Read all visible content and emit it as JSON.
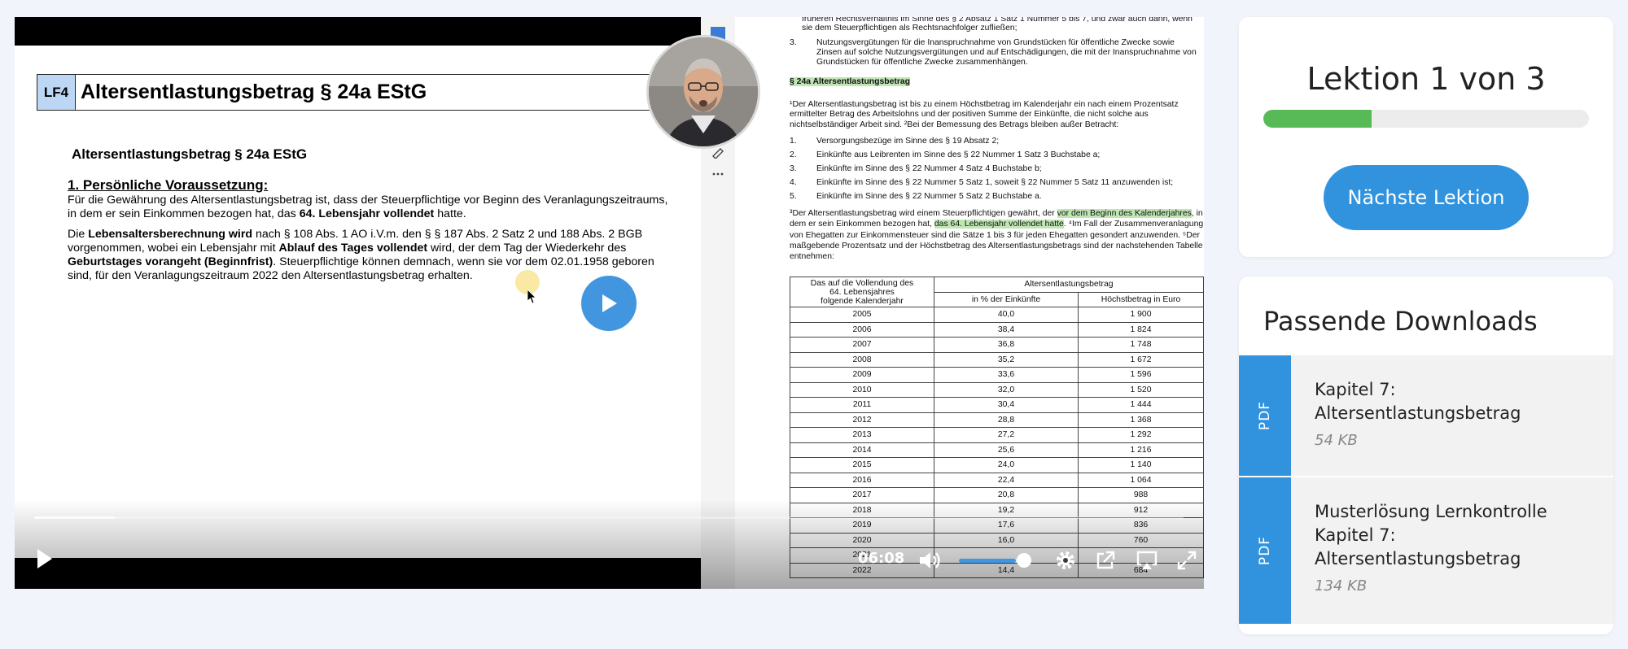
{
  "video": {
    "slide": {
      "tag": "LF4",
      "title": "Altersentlastungsbetrag  § 24a EStG",
      "subtitle": "Altersentlastungsbetrag  § 24a EStG",
      "section": "1. Persönliche Voraussetzung:",
      "p1_a": "Für die Gewährung des Altersentlastungsbetrag ist, dass der Steuerpflichtige vor Beginn des Veranlagungszeitraums,",
      "p1_b": "in dem er sein Einkommen bezogen hat, das ",
      "p1_bold": "64. Lebensjahr vollendet",
      "p1_c": " hatte.",
      "p2_l1a": "Die ",
      "p2_l1b": "Lebensaltersberechnung wird",
      "p2_l1c": " nach  §  108 Abs. 1 AO i.V.m. den  §  §  187 Abs. 2 Satz 2 und 188 Abs. 2 BGB",
      "p2_l2a": "vorgenommen, wobei ein Lebensjahr mit ",
      "p2_l2b": "Ablauf des Tages vollendet",
      "p2_l2c": " wird, der dem Tag der Wiederkehr des",
      "p2_l3a": "Geburtstages vorangeht (Beginnfrist)",
      "p2_l3b": ". Steuerpflichtige können demnach, wenn sie vor dem 02.01.1958 geboren",
      "p2_l4": "sind, für den Veranlagungszeitraum 2022 den Altersentlastungsbetrag erhalten."
    },
    "doc": {
      "top1": "früheren Rechtsverhältnis im Sinne des § 2 Absatz 1 Satz 1 Nummer 5 bis 7, und zwar auch dann, wenn",
      "top2": "sie dem Steuerpflichtigen als Rechtsnachfolger zufließen;",
      "item3_num": "3.",
      "item3_l1": "Nutzungsvergütungen für die Inanspruchnahme von Grundstücken für öffentliche Zwecke sowie",
      "item3_l2": "Zinsen auf solche Nutzungsvergütungen und auf Entschädigungen, die mit der Inanspruchnahme von",
      "item3_l3": "Grundstücken für öffentliche Zwecke zusammenhängen.",
      "heading": "§ 24a Altersentlastungsbetrag",
      "p1_l1": "¹Der Altersentlastungsbetrag ist bis zu einem Höchstbetrag im Kalenderjahr ein nach einem Prozentsatz",
      "p1_l2": "ermittelter Betrag des Arbeitslohns und der positiven Summe der Einkünfte, die nicht solche aus",
      "p1_l3": "nichtselbständiger Arbeit sind. ²Bei der Bemessung des Betrags bleiben außer Betracht:",
      "list": [
        {
          "n": "1.",
          "t": "Versorgungsbezüge im Sinne des § 19 Absatz 2;"
        },
        {
          "n": "2.",
          "t": "Einkünfte aus Leibrenten im Sinne des § 22 Nummer 1 Satz 3 Buchstabe a;"
        },
        {
          "n": "3.",
          "t": "Einkünfte im Sinne des § 22 Nummer 4 Satz 4 Buchstabe b;"
        },
        {
          "n": "4.",
          "t": "Einkünfte im Sinne des § 22 Nummer 5 Satz 1, soweit § 22 Nummer 5 Satz 11 anzuwenden ist;"
        },
        {
          "n": "5.",
          "t": "Einkünfte im Sinne des § 22 Nummer 5 Satz 2 Buchstabe a."
        }
      ],
      "p2_l1a": "³Der Altersentlastungsbetrag wird einem Steuerpflichtigen gewährt, der ",
      "p2_l1hl": "vor dem Beginn des Kalenderjahres",
      "p2_l1b": ", in",
      "p2_l2a": "dem er sein Einkommen bezogen hat, ",
      "p2_l2hl": "das 64. Lebensjahr vollendet hatte",
      "p2_l2b": ". ⁴Im Fall der Zusammenveranlagung",
      "p2_l3": "von Ehegatten zur Einkommensteuer sind die Sätze 1 bis 3 für jeden Ehegatten gesondert anzuwenden. ⁵Der",
      "p2_l4": "maßgebende Prozentsatz und der Höchstbetrag des Altersentlastungsbetrags sind der nachstehenden Tabelle zu",
      "p2_l5": "entnehmen:",
      "table": {
        "col1_l1": "Das auf die Vollendung des",
        "col1_l2": "64. Lebensjahres",
        "col1_l3": "folgende Kalenderjahr",
        "group": "Altersentlastungsbetrag",
        "col2": "in % der Einkünfte",
        "col3": "Höchstbetrag in Euro",
        "rows": [
          [
            "2005",
            "40,0",
            "1 900"
          ],
          [
            "2006",
            "38,4",
            "1 824"
          ],
          [
            "2007",
            "36,8",
            "1 748"
          ],
          [
            "2008",
            "35,2",
            "1 672"
          ],
          [
            "2009",
            "33,6",
            "1 596"
          ],
          [
            "2010",
            "32,0",
            "1 520"
          ],
          [
            "2011",
            "30,4",
            "1 444"
          ],
          [
            "2012",
            "28,8",
            "1 368"
          ],
          [
            "2013",
            "27,2",
            "1 292"
          ],
          [
            "2014",
            "25,6",
            "1 216"
          ],
          [
            "2015",
            "24,0",
            "1 140"
          ],
          [
            "2016",
            "22,4",
            "1 064"
          ],
          [
            "2017",
            "20,8",
            "988"
          ],
          [
            "2018",
            "19,2",
            "912"
          ],
          [
            "2019",
            "17,6",
            "836"
          ],
          [
            "2020",
            "16,0",
            "760"
          ],
          [
            "2021",
            "",
            ""
          ],
          [
            "2022",
            "14,4",
            "684"
          ]
        ]
      }
    },
    "controls": {
      "time": "06:08",
      "progress": 0.07,
      "volume": 0.85
    }
  },
  "lesson": {
    "title": "Lektion 1 von 3",
    "progress": 0.333,
    "next_label": "Nächste Lektion"
  },
  "downloads": {
    "title": "Passende Downloads",
    "items": [
      {
        "badge": "PDF",
        "name_l1": "Kapitel 7:",
        "name_l2": "Altersentlastungsbetrag",
        "name_l3": "",
        "size": "54 KB"
      },
      {
        "badge": "PDF",
        "name_l1": "Musterlösung Lernkontrolle",
        "name_l2": "Kapitel 7:",
        "name_l3": "Altersentlastungsbetrag",
        "size": "134 KB"
      }
    ]
  },
  "colors": {
    "accent": "#3193de",
    "progress_green": "#58b957",
    "doc_highlight": "#bfe6b3"
  }
}
